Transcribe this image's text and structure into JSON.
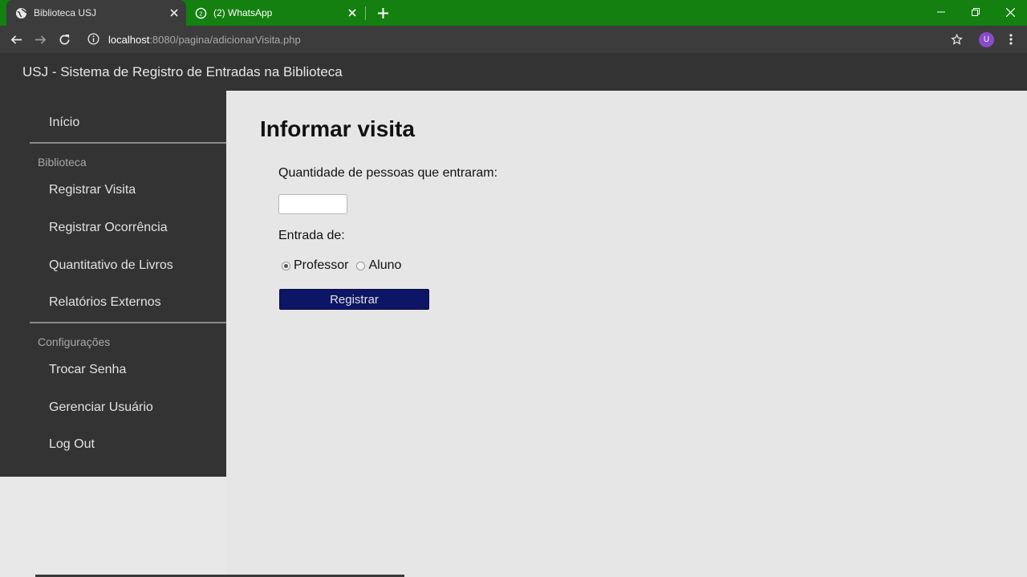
{
  "browser": {
    "tabs": [
      {
        "title": "Biblioteca USJ",
        "active": true
      },
      {
        "title": "(2) WhatsApp",
        "active": false
      }
    ],
    "address": {
      "host": "localhost",
      "path": ":8080/pagina/adicionarVisita.php"
    },
    "profile_initial": "U",
    "colors": {
      "tabbar": "#138010",
      "toolbar": "#3c3c3c"
    }
  },
  "app": {
    "title": "USJ - Sistema de Registro de Entradas na Biblioteca"
  },
  "sidebar": {
    "home": "Início",
    "sections": [
      {
        "title": "Biblioteca",
        "items": [
          "Registrar Visita",
          "Registrar Ocorrência",
          "Quantitativo de Livros",
          "Relatórios Externos"
        ]
      },
      {
        "title": "Configurações",
        "items": [
          "Trocar Senha",
          "Gerenciar Usuário",
          "Log Out"
        ]
      }
    ]
  },
  "form": {
    "title": "Informar visita",
    "quantity_label": "Quantidade de pessoas que entraram:",
    "quantity_value": "",
    "entry_label": "Entrada de:",
    "options": [
      {
        "label": "Professor",
        "checked": true
      },
      {
        "label": "Aluno",
        "checked": false
      }
    ],
    "submit_label": "Registrar",
    "submit_color": "#0c1566"
  }
}
